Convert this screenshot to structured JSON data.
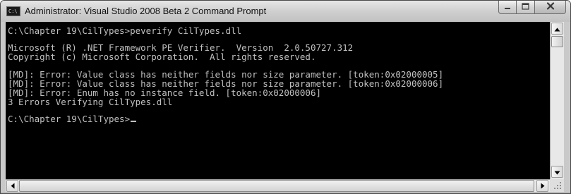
{
  "window": {
    "title": "Administrator: Visual Studio 2008 Beta 2 Command Prompt",
    "icon": "command-prompt-icon",
    "icon_text": "C:\\"
  },
  "caption_buttons": {
    "minimize_icon": "minimize-icon",
    "maximize_icon": "maximize-icon",
    "close_icon": "close-icon"
  },
  "console": {
    "background": "#000000",
    "foreground": "#c0c0c0",
    "lines": [
      "C:\\Chapter 19\\CilTypes>peverify CilTypes.dll",
      "",
      "Microsoft (R) .NET Framework PE Verifier.  Version  2.0.50727.312",
      "Copyright (c) Microsoft Corporation.  All rights reserved.",
      "",
      "[MD]: Error: Value class has neither fields nor size parameter. [token:0x02000005]",
      "[MD]: Error: Value class has neither fields nor size parameter. [token:0x02000006]",
      "[MD]: Error: Enum has no instance field. [token:0x02000006]",
      "3 Errors Verifying CilTypes.dll",
      "",
      "C:\\Chapter 19\\CilTypes>"
    ]
  },
  "scrollbars": {
    "up_icon": "arrow-up-icon",
    "down_icon": "arrow-down-icon",
    "left_icon": "arrow-left-icon",
    "right_icon": "arrow-right-icon"
  }
}
